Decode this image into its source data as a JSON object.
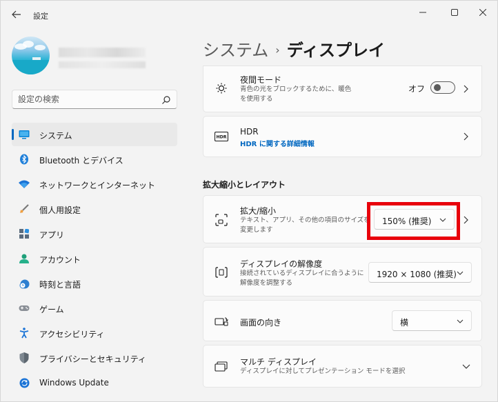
{
  "window": {
    "title": "設定"
  },
  "sidebar": {
    "search_placeholder": "設定の検索",
    "items": [
      {
        "label": "システム",
        "icon": "system-icon",
        "active": true
      },
      {
        "label": "Bluetooth とデバイス",
        "icon": "bluetooth-icon"
      },
      {
        "label": "ネットワークとインターネット",
        "icon": "wifi-icon"
      },
      {
        "label": "個人用設定",
        "icon": "brush-icon"
      },
      {
        "label": "アプリ",
        "icon": "apps-icon"
      },
      {
        "label": "アカウント",
        "icon": "account-icon"
      },
      {
        "label": "時刻と言語",
        "icon": "clock-globe-icon"
      },
      {
        "label": "ゲーム",
        "icon": "gamepad-icon"
      },
      {
        "label": "アクセシビリティ",
        "icon": "accessibility-icon"
      },
      {
        "label": "プライバシーとセキュリティ",
        "icon": "shield-icon"
      },
      {
        "label": "Windows Update",
        "icon": "update-icon"
      }
    ]
  },
  "breadcrumb": {
    "parent": "システム",
    "separator": "›",
    "current": "ディスプレイ"
  },
  "cards": {
    "night_mode": {
      "title": "夜間モード",
      "desc_line1": "青色の光をブロックするために、暖色",
      "desc_line2": "を使用する",
      "toggle_label": "オフ",
      "toggle_on": false
    },
    "hdr": {
      "title": "HDR",
      "link": "HDR に関する詳細情報"
    },
    "section_title": "拡大縮小とレイアウト",
    "scale": {
      "title": "拡大/縮小",
      "desc_line1": "テキスト、アプリ、その他の項目のサイズを",
      "desc_line2": "変更します",
      "value": "150% (推奨)"
    },
    "resolution": {
      "title": "ディスプレイの解像度",
      "desc_line1": "接続されているディスプレイに合うように",
      "desc_line2": "解像度を調整する",
      "value": "1920 × 1080 (推奨)"
    },
    "orientation": {
      "title": "画面の向き",
      "value": "横"
    },
    "multi_display": {
      "title": "マルチ ディスプレイ",
      "desc": "ディスプレイに対してプレゼンテーション モードを選択"
    }
  },
  "colors": {
    "accent": "#0067c0",
    "highlight": "#e8000b"
  }
}
